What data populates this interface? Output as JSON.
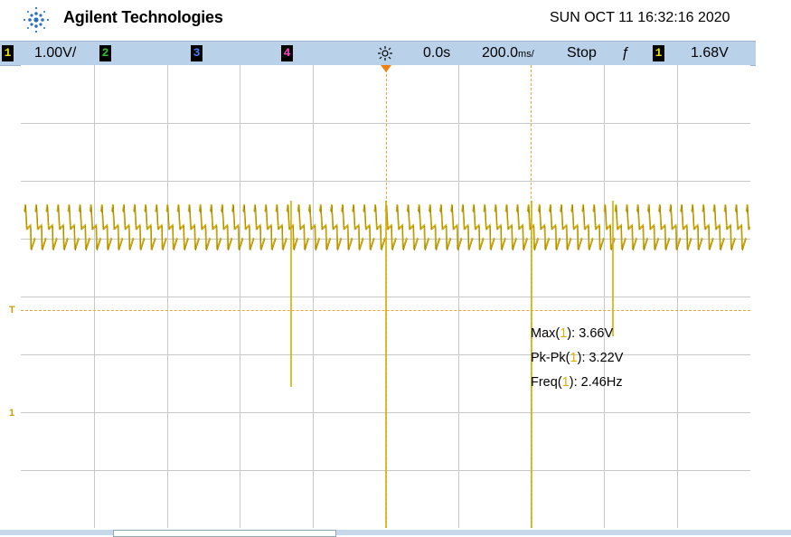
{
  "header": {
    "brand": "Agilent Technologies",
    "datetime": "SUN OCT 11 16:32:16 2020"
  },
  "status": {
    "ch1_num": "1",
    "ch1_scale": "1.00V/",
    "ch2_num": "2",
    "ch3_num": "3",
    "ch4_num": "4",
    "delay": "0.0s",
    "timebase": "200.0",
    "timebase_unit": "ms/",
    "run_state": "Stop",
    "trig_slope": "ƒ",
    "trig_ch": "1",
    "trig_level": "1.68V",
    "colors": {
      "ch1": "#e8e000",
      "ch2": "#2ec42e",
      "ch3": "#4d7cff",
      "ch4": "#ff40c8"
    }
  },
  "markers": {
    "trigger_level": "T",
    "ch1_ground": "1"
  },
  "measurements": [
    {
      "name": "Max",
      "ch": "1",
      "value": ": 3.66V"
    },
    {
      "name": "Pk-Pk",
      "ch": "1",
      "value": ": 3.22V"
    },
    {
      "name": "Freq",
      "ch": "1",
      "value": ": 2.46Hz"
    }
  ],
  "trace": {
    "color": "#d4b000",
    "edge_color": "#8a6a00"
  }
}
